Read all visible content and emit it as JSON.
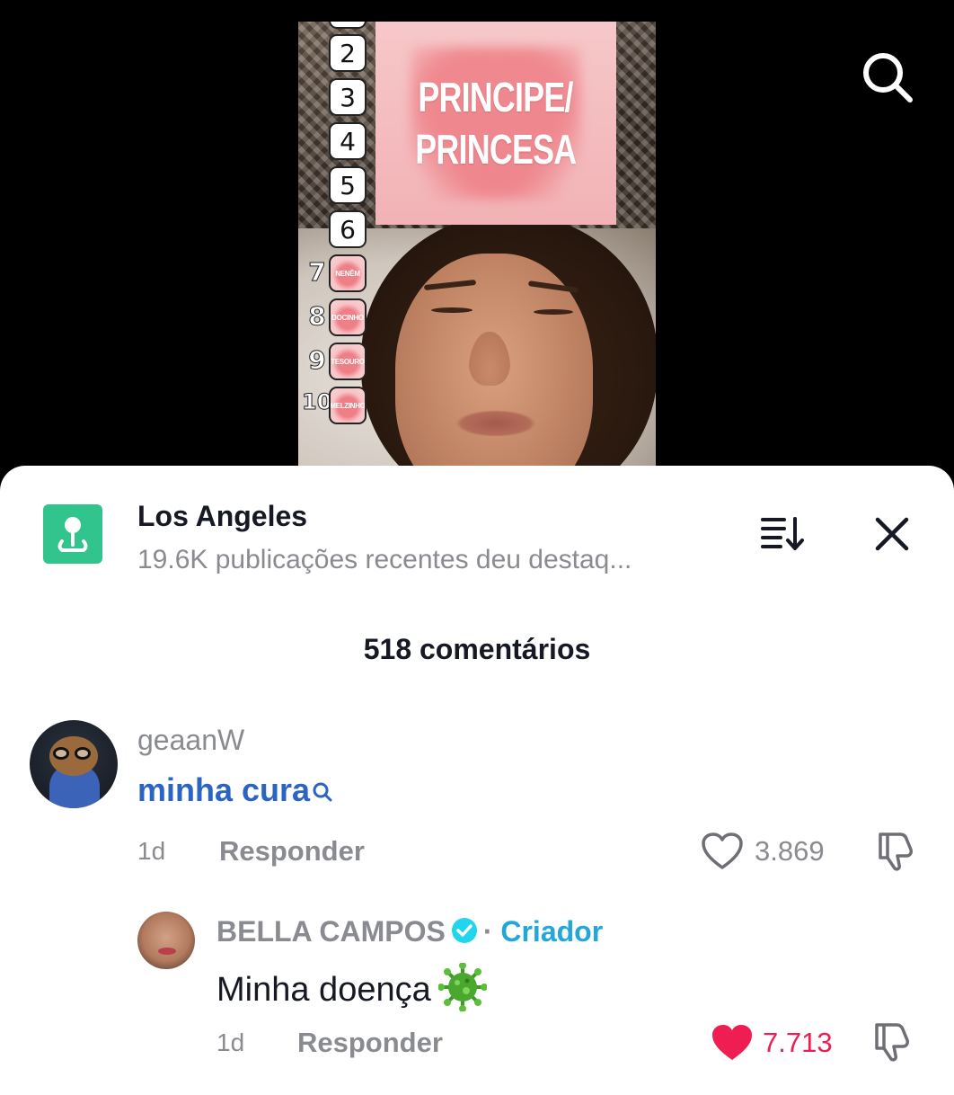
{
  "video": {
    "card_lines": [
      "PRINCIPE/",
      "PRINCESA"
    ],
    "numbers_boxed": [
      "2",
      "3",
      "4",
      "5",
      "6"
    ],
    "numbers_side": [
      "7",
      "8",
      "9",
      "10"
    ],
    "heart_labels": [
      "NENÊM",
      "DOCINHO",
      "TESOURO",
      "MELZINHO"
    ],
    "search_icon": "search-icon"
  },
  "sheet": {
    "location": {
      "icon": "map-pin-icon",
      "icon_color": "#32c48d",
      "title": "Los Angeles",
      "subtitle": "19.6K publicações recentes deu destaq..."
    },
    "sort_icon": "sort-icon",
    "close_icon": "close-icon",
    "comment_count": "518 comentários",
    "comments": [
      {
        "user": "geaanW",
        "text": "minha cura",
        "text_color": "#2c64c3",
        "time": "1d",
        "reply_label": "Responder",
        "likes": "3.869",
        "liked": false
      },
      {
        "user": "BELLA CAMPOS",
        "verified": true,
        "separator": "·",
        "badge": "Criador",
        "badge_color": "#21a7d8",
        "text": "Minha doença",
        "time": "1d",
        "reply_label": "Responder",
        "likes": "7.713",
        "liked": true,
        "like_color": "#ee1d52"
      }
    ]
  }
}
